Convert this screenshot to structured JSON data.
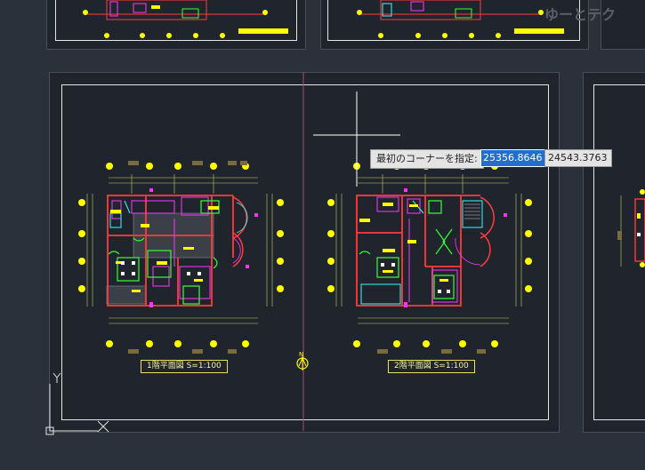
{
  "drawing": {
    "sheet_title_1": "1階平面図 S=1:100",
    "sheet_title_2": "2階平面図 S=1:100",
    "north_label": "N",
    "watermark": "ゆーとテク"
  },
  "prompt": {
    "label": "最初のコーナーを指定:",
    "x_value": "25356.8646",
    "y_value": "24543.3763"
  },
  "ucs": {
    "x_label": "X",
    "y_label": "Y"
  },
  "colors": {
    "background": "#2b313b",
    "sheet": "#20252d",
    "wall": "#ff3b3b",
    "magenta": "#ff35ff",
    "green": "#37ff37",
    "yellow": "#ffff00",
    "cyan": "#35ffff",
    "highlight": "#1f6fcf"
  }
}
